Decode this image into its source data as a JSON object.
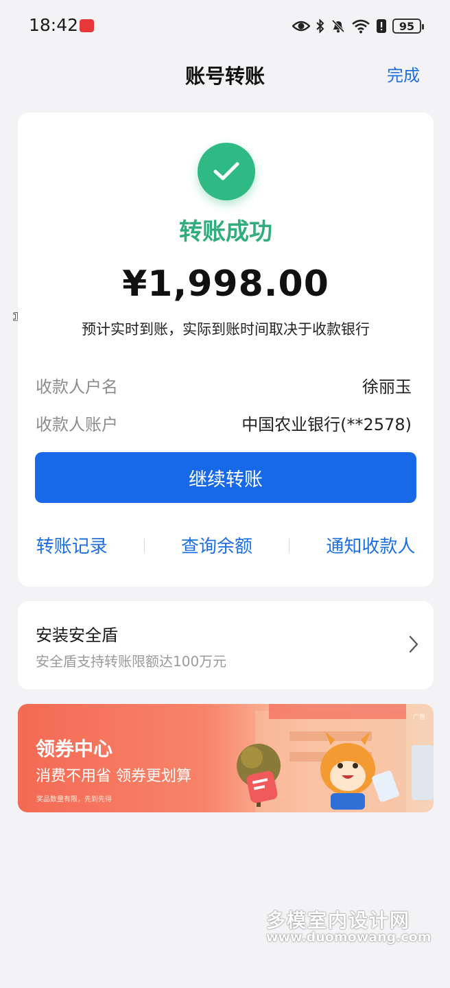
{
  "status_bar": {
    "time": "18:42",
    "battery": "95",
    "icons": [
      "eye-icon",
      "bluetooth-icon",
      "bell-off-icon",
      "wifi-icon",
      "alert-icon",
      "battery-icon"
    ]
  },
  "header": {
    "title": "账号转账",
    "done_label": "完成"
  },
  "result": {
    "status_text": "转账成功",
    "amount": "¥1,998.00",
    "arrival_note": "预计实时到账，实际到账时间取决于收款银行",
    "payee_name_label": "收款人户名",
    "payee_name_value": "徐丽玉",
    "payee_account_label": "收款人账户",
    "payee_account_value": "中国农业银行(**2578)",
    "continue_button": "继续转账",
    "actions": [
      "转账记录",
      "查询余额",
      "通知收款人"
    ]
  },
  "security": {
    "title": "安装安全盾",
    "subtitle": "安全盾支持转账限额达100万元"
  },
  "banner": {
    "title": "领券中心",
    "subtitle": "消费不用省 领券更划算",
    "fine_print": "奖品数量有限，先到先得",
    "ad_tag": "广告"
  },
  "watermarks": {
    "side": "100879",
    "site_name": "多模室内设计网",
    "site_url": "www.duomowang.com"
  },
  "colors": {
    "accent_blue": "#1769e8",
    "success_green": "#2fba84",
    "background": "#f3f3f5"
  }
}
